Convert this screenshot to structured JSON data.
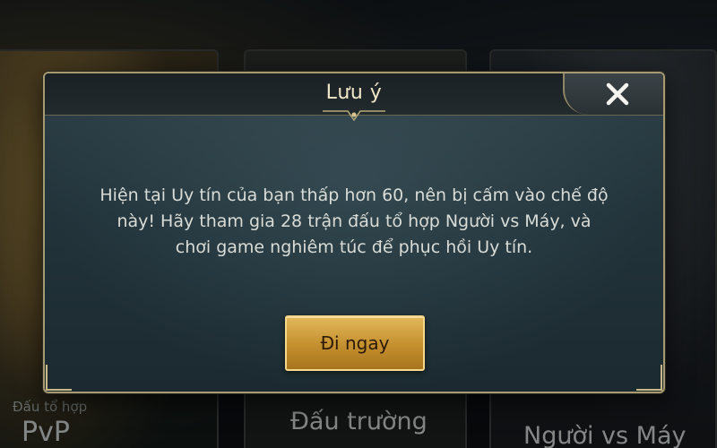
{
  "background": {
    "cards": [
      {
        "subtitle": "Đấu tổ hợp",
        "title": "PvP"
      },
      {
        "title": "Đấu trường"
      },
      {
        "title": "Người vs Máy"
      }
    ]
  },
  "dialog": {
    "title": "Lưu ý",
    "close_icon": "close-x-icon",
    "message": "Hiện tại Uy tín của bạn thấp hơn 60,  nên bị cấm vào chế độ này! Hãy tham gia 28 trận đấu tổ hợp Người vs Máy, và chơi game nghiêm túc để phục hồi Uy tín.",
    "confirm_label": "Đi ngay"
  },
  "colors": {
    "accent_gold": "#c48f2e",
    "dialog_bg": "#22333a",
    "title_text": "#f0e6c8"
  }
}
